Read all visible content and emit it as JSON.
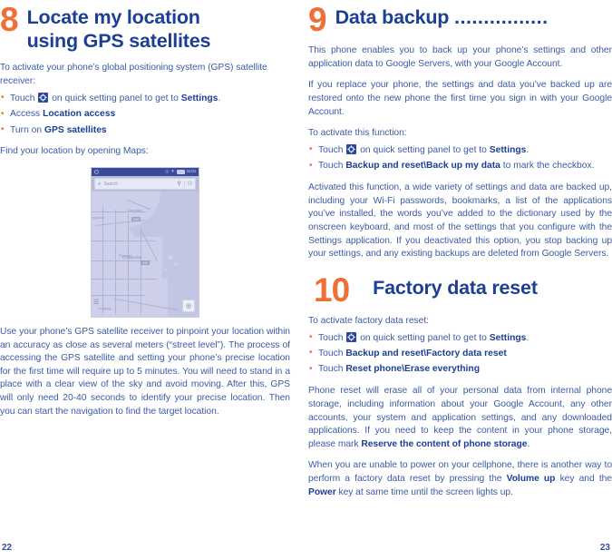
{
  "document": {
    "type": "user-manual-spread",
    "colors": {
      "accent_orange": "#EE7035",
      "heading_blue": "#1C3F94",
      "body_blue": "#3B5BA5",
      "page_background": "#FFFFFF"
    }
  },
  "left_page": {
    "folio": "22",
    "section": {
      "number": "8",
      "title_line1": "Locate my location",
      "title_line2": "using GPS satellites"
    },
    "intro": "To activate your phone’s global positioning system (GPS) satellite receiver:",
    "bullets": [
      {
        "prefix": "Touch ",
        "icon": "gear-icon",
        "mid": " on quick setting panel to get to ",
        "bold": "Settings",
        "suffix": "."
      },
      {
        "prefix": "Access ",
        "icon": "",
        "mid": "",
        "bold": "Location access",
        "suffix": ""
      },
      {
        "prefix": "Turn on ",
        "icon": "",
        "mid": "",
        "bold": "GPS satellites",
        "suffix": ""
      }
    ],
    "after_bullets": "Find your location by opening Maps:",
    "screenshot": {
      "name": "maps-app-screenshot",
      "status_bar": {
        "clock": "21:01"
      },
      "search_placeholder": "Search",
      "icons": [
        "search-icon",
        "directions-icon",
        "person-icon",
        "layers-icon",
        "my-location-icon"
      ],
      "map_labels": [
        "Jiangzhou",
        "Chuansha",
        "G40",
        "S20"
      ]
    },
    "closing": "Use your phone’s GPS satellite receiver to pinpoint your location within an accuracy as close as several meters (“street level”). The process of accessing the GPS satellite and setting your phone’s precise location for the first time will require up to 5 minutes. You will need to stand in a place with a clear view of the sky and avoid moving. After this, GPS will only need 20-40 seconds to identify your precise location. Then you can start the navigation to find the target location."
  },
  "right_page": {
    "folio": "23",
    "section9": {
      "number": "9",
      "title": "Data backup ",
      "dots": "................",
      "paragraph1": "This phone enables you to back up your phone’s settings and other application data to Google Servers, with your Google Account.",
      "paragraph2": "If you replace your phone, the settings and data you’ve backed up are restored onto the new phone the first time you sign in with your Google Account.",
      "activate_label": "To activate this function:",
      "bullets": [
        {
          "prefix": "Touch ",
          "icon": "gear-icon",
          "mid": " on quick setting panel to get to ",
          "bold": "Settings",
          "suffix": "."
        },
        {
          "prefix": "Touch ",
          "icon": "",
          "mid": "",
          "bold": "Backup and reset\\Back up my data",
          "suffix": " to mark the checkbox."
        }
      ],
      "paragraph3": "Activated this function, a wide variety of settings and data are backed up, including your Wi-Fi passwords, bookmarks, a list of the applications you’ve installed, the words you’ve added to the dictionary used by the onscreen keyboard, and most of the settings that you configure with the Settings application. If you deactivated this option, you stop backing up your settings, and any existing backups are deleted from Google Servers."
    },
    "section10": {
      "number": "10",
      "title": "Factory data reset",
      "activate_label": "To activate factory data reset:",
      "bullets": [
        {
          "prefix": "Touch ",
          "icon": "gear-icon",
          "mid": " on quick setting panel to get to ",
          "bold": "Settings",
          "suffix": "."
        },
        {
          "prefix": "Touch ",
          "icon": "",
          "mid": "",
          "bold": "Backup and reset\\Factory data reset",
          "suffix": ""
        },
        {
          "prefix": "Touch ",
          "icon": "",
          "mid": "",
          "bold": "Reset phone\\Erase everything",
          "suffix": ""
        }
      ],
      "paragraph1_a": "Phone reset will erase all of your personal data from internal phone storage, including information about your Google Account, any other accounts, your system and application settings, and any downloaded applications. If you need to keep the content in your phone storage, please mark ",
      "paragraph1_bold": "Reserve the content of phone storage",
      "paragraph1_b": ".",
      "paragraph2_a": "When you are unable to power on your cellphone, there is another way to perform a factory data reset by pressing the ",
      "paragraph2_bold1": "Volume up",
      "paragraph2_mid": " key and the ",
      "paragraph2_bold2": "Power",
      "paragraph2_b": " key at same time until the screen lights up."
    }
  }
}
